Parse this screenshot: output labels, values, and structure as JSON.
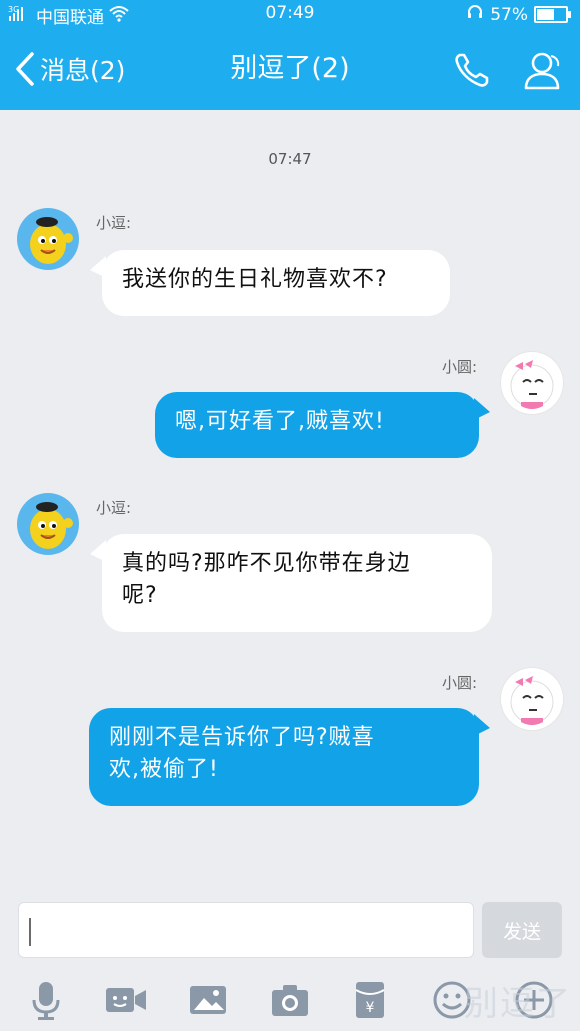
{
  "status_bar": {
    "network_badge": "3G",
    "carrier": "中国联通",
    "time": "07:49",
    "battery_percent": "57%",
    "battery_level": 0.57
  },
  "header": {
    "back_label": "消息(2)",
    "title": "别逗了(2)",
    "icons": [
      "back-chevron-icon",
      "phone-icon",
      "profile-icon"
    ]
  },
  "chat": {
    "timestamp": "07:47",
    "messages": [
      {
        "sender": "小逗:",
        "side": "left",
        "text": "我送你的生日礼物喜欢不?"
      },
      {
        "sender": "小圆:",
        "side": "right",
        "text": "嗯,可好看了,贼喜欢!"
      },
      {
        "sender": "小逗:",
        "side": "left",
        "text_line1": "真的吗?那咋不见你带在身边",
        "text_line2": "呢?"
      },
      {
        "sender": "小圆:",
        "side": "right",
        "text_line1": "刚刚不是告诉你了吗?贼喜",
        "text_line2": "欢,被偷了!"
      }
    ]
  },
  "composer": {
    "input_value": "",
    "send_label": "发送"
  },
  "toolbar": {
    "icons": [
      "microphone-icon",
      "video-icon",
      "image-icon",
      "camera-icon",
      "red-packet-icon",
      "emoji-icon",
      "plus-icon"
    ]
  },
  "watermark": "别逗了",
  "colors": {
    "header_blue": "#1eaef0",
    "outgoing_bubble": "#12a2e8",
    "incoming_bubble": "#ffffff",
    "background": "#ebedf1"
  }
}
